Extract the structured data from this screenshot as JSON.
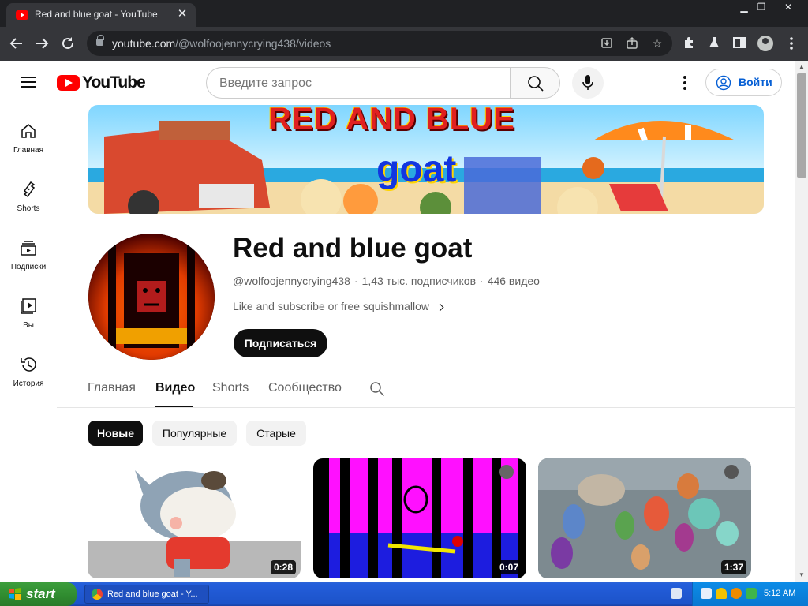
{
  "browser": {
    "tab_title": "Red and blue goat - YouTube",
    "tab_close": "✕",
    "url_host": "youtube.com",
    "url_path": "/@wolfoojennycrying438/videos",
    "window_min": "▁",
    "window_restore": "❐",
    "window_close": "✕"
  },
  "masthead": {
    "logo_text": "YouTube",
    "search_placeholder": "Введите запрос",
    "signin_label": "Войти"
  },
  "guide": [
    {
      "label": "Главная",
      "icon": "home-icon"
    },
    {
      "label": "Shorts",
      "icon": "shorts-icon"
    },
    {
      "label": "Подписки",
      "icon": "subscriptions-icon"
    },
    {
      "label": "Вы",
      "icon": "library-icon"
    },
    {
      "label": "История",
      "icon": "history-icon"
    }
  ],
  "banner": {
    "line1": "RED AND BLUE",
    "line2": "goat"
  },
  "channel": {
    "name": "Red and blue goat",
    "handle": "@wolfoojennycrying438",
    "subscribers": "1,43 тыс. подписчиков",
    "video_count": "446 видео",
    "description": "Like and subscribe or free squishmallow",
    "subscribe_label": "Подписаться"
  },
  "tabs": [
    {
      "label": "Главная"
    },
    {
      "label": "Видео"
    },
    {
      "label": "Shorts"
    },
    {
      "label": "Сообщество"
    }
  ],
  "chips": [
    {
      "label": "Новые"
    },
    {
      "label": "Популярные"
    },
    {
      "label": "Старые"
    }
  ],
  "videos": [
    {
      "duration": "0:28"
    },
    {
      "duration": "0:07"
    },
    {
      "duration": "1:37"
    }
  ],
  "taskbar": {
    "start_label": "start",
    "task_label": "Red and blue goat - Y...",
    "clock": "5:12 AM"
  },
  "colors": {
    "youtube_red": "#ff0000",
    "link_blue": "#065fd4",
    "xp_taskbar": "#245edb",
    "xp_start_green": "#2f8a2f"
  }
}
